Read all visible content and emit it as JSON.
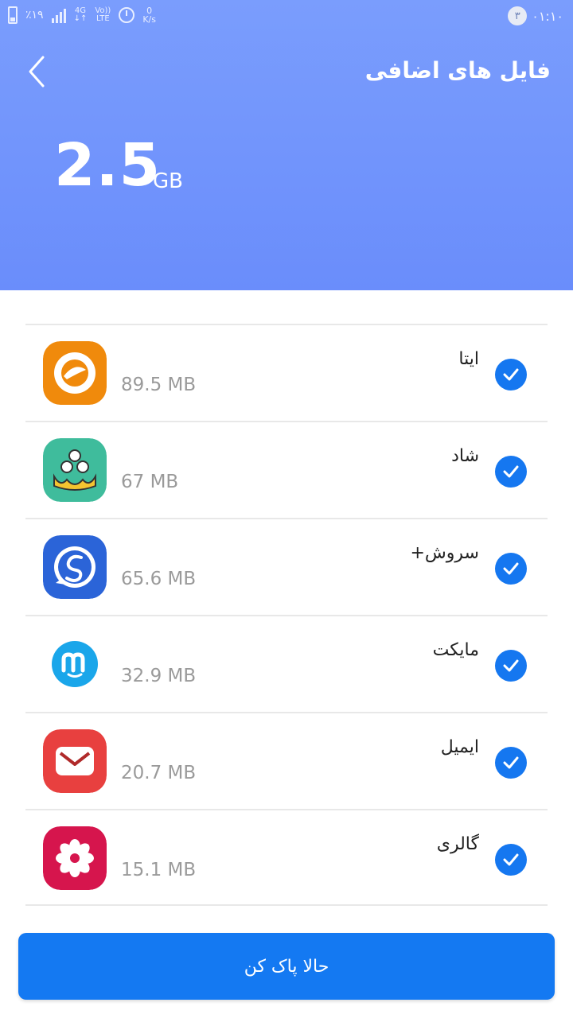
{
  "status_bar": {
    "battery": "٪۱۹",
    "network_top": "4G",
    "lte_top": "Vo))",
    "lte_bottom": "LTE",
    "speed_top": "0",
    "speed_bottom": "K/s",
    "notification_count": "۳",
    "time": "۰۱:۱۰"
  },
  "header": {
    "title": "فایل های اضافی",
    "size_value": "2.5",
    "size_unit": "GB"
  },
  "apps": [
    {
      "name": "ایتا",
      "size": "89.5 MB",
      "icon": "eitaa-icon",
      "checked": true
    },
    {
      "name": "شاد",
      "size": "67 MB",
      "icon": "shad-icon",
      "checked": true
    },
    {
      "name": "سروش+",
      "size": "65.6 MB",
      "icon": "soroush-icon",
      "checked": true
    },
    {
      "name": "مایکت",
      "size": "32.9 MB",
      "icon": "myket-icon",
      "checked": true
    },
    {
      "name": "ایمیل",
      "size": "20.7 MB",
      "icon": "email-icon",
      "checked": true
    },
    {
      "name": "گالری",
      "size": "15.1 MB",
      "icon": "gallery-icon",
      "checked": true
    }
  ],
  "action": {
    "clean_label": "حالا پاک کن"
  },
  "colors": {
    "header": "#7a9dfd",
    "accent": "#1479f2"
  }
}
